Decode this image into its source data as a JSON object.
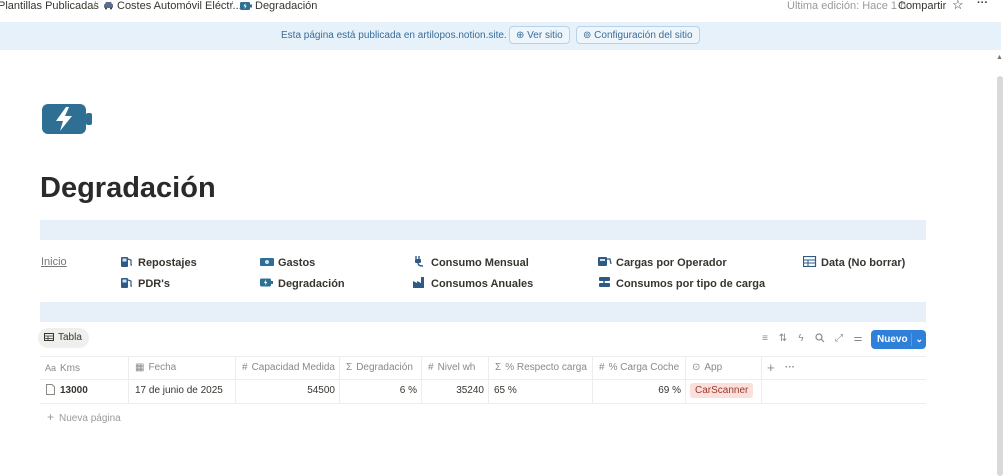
{
  "topbar": {
    "breadcrumbs": [
      {
        "label": "Plantillas Publicadas",
        "icon": "page-icon"
      },
      {
        "label": "Costes Automóvil Eléctr...",
        "icon": "car-icon"
      },
      {
        "label": "Degradación",
        "icon": "battery-icon"
      }
    ],
    "last_edit": "Última edición: Hace 1 h",
    "share": "Compartir",
    "favorite_icon": "star-icon",
    "more_icon": "ellipsis-icon"
  },
  "banner": {
    "text": "Esta página está publicada en artilopos.notion.site.",
    "view_site": "Ver sitio",
    "site_settings": "Configuración del sitio"
  },
  "page": {
    "icon": "battery-charging-icon",
    "title": "Degradación"
  },
  "nav": {
    "home": "Inicio",
    "links": [
      {
        "label": "Repostajes",
        "icon": "fuel-pump-icon"
      },
      {
        "label": "Gastos",
        "icon": "money-icon"
      },
      {
        "label": "Consumo Mensual",
        "icon": "plug-icon"
      },
      {
        "label": "Cargas por Operador",
        "icon": "charging-station-icon"
      },
      {
        "label": "Data (No borrar)",
        "icon": "table-icon"
      },
      {
        "label": "PDR's",
        "icon": "fuel-pump-icon"
      },
      {
        "label": "Degradación",
        "icon": "battery-icon"
      },
      {
        "label": "Consumos Anuales",
        "icon": "factory-icon"
      },
      {
        "label": "Consumos por tipo de carga",
        "icon": "charger-icon"
      }
    ]
  },
  "database": {
    "view_tab": "Tabla",
    "new_button": "Nuevo",
    "columns": [
      {
        "label": "Kms",
        "type_icon": "Aa"
      },
      {
        "label": "Fecha",
        "type_icon": "calendar-icon"
      },
      {
        "label": "Capacidad Medida",
        "type_icon": "#"
      },
      {
        "label": "Degradación",
        "type_icon": "Σ"
      },
      {
        "label": "Nivel wh",
        "type_icon": "#"
      },
      {
        "label": "% Respecto carga",
        "type_icon": "Σ"
      },
      {
        "label": "% Carga Coche",
        "type_icon": "#"
      },
      {
        "label": "App",
        "type_icon": "select-icon"
      }
    ],
    "rows": [
      {
        "kms": "13000",
        "fecha": "17 de junio de 2025",
        "capacidad": "54500",
        "degradacion": "6 %",
        "nivel": "35240",
        "respecto": "65 %",
        "carga": "69 %",
        "app": "CarScanner"
      }
    ],
    "new_page": "Nueva página"
  },
  "colors": {
    "banner_bg": "#e6f1fa",
    "accent": "#2f80d8",
    "callout_bg": "#e7f0f8",
    "tag_bg": "#fbdfdb"
  }
}
